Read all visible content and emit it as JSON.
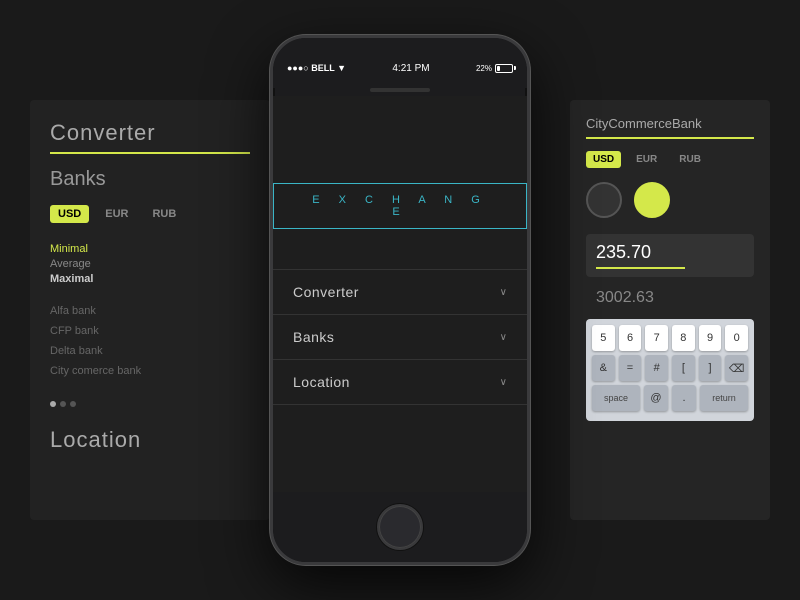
{
  "background": {
    "color": "#1a1a1a"
  },
  "left_panel": {
    "title": "Converter",
    "banks_title": "Banks",
    "currencies": [
      "USD",
      "EUR",
      "RUB"
    ],
    "active_currency": "USD",
    "stats": [
      {
        "label": "Minimal",
        "style": "yellow"
      },
      {
        "label": "Average",
        "style": "grey"
      },
      {
        "label": "Maximal",
        "style": "white"
      }
    ],
    "banks": [
      "Alfa bank",
      "CFP bank",
      "Delta bank",
      "City comerce bank"
    ],
    "location_title": "Location"
  },
  "right_panel": {
    "title": "CityCommerceBank",
    "currencies": [
      "USD",
      "EUR",
      "RUB"
    ],
    "active_currency": "USD",
    "input_value": "235.70",
    "output_value": "3002.63",
    "keyboard_rows": [
      [
        "5",
        "6",
        "7",
        "8",
        "9",
        "0"
      ],
      [
        "&",
        "=",
        "#",
        "[",
        "]"
      ],
      [
        "space",
        "@",
        ".",
        "return"
      ]
    ]
  },
  "phone": {
    "status_left": "●●●○ BELL ▼",
    "status_center": "4:21 PM",
    "status_right": "22%",
    "exchange_label": "E X C H A N G E",
    "menu_items": [
      {
        "label": "Converter",
        "id": "converter"
      },
      {
        "label": "Banks",
        "id": "banks"
      },
      {
        "label": "Location",
        "id": "location"
      }
    ],
    "chevron": "∨"
  }
}
